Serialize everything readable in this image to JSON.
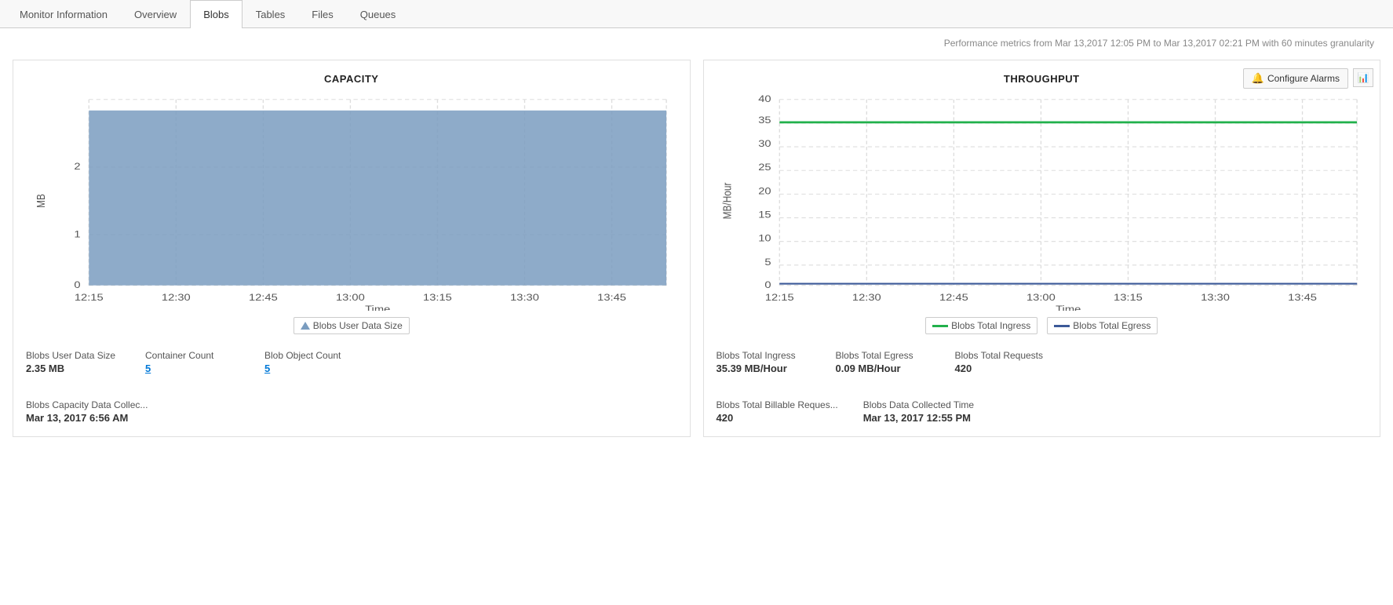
{
  "app": {
    "title": "Monitor Information"
  },
  "nav": {
    "tabs": [
      {
        "id": "monitor-information",
        "label": "Monitor Information",
        "active": false
      },
      {
        "id": "overview",
        "label": "Overview",
        "active": false
      },
      {
        "id": "blobs",
        "label": "Blobs",
        "active": true
      },
      {
        "id": "tables",
        "label": "Tables",
        "active": false
      },
      {
        "id": "files",
        "label": "Files",
        "active": false
      },
      {
        "id": "queues",
        "label": "Queues",
        "active": false
      }
    ]
  },
  "metrics_info": "Performance metrics from Mar 13,2017 12:05 PM to Mar 13,2017 02:21 PM with 60 minutes granularity",
  "capacity_panel": {
    "title": "CAPACITY",
    "x_axis_label": "Time",
    "y_axis_label": "MB",
    "x_ticks": [
      "12:15",
      "12:30",
      "12:45",
      "13:00",
      "13:15",
      "13:30",
      "13:45"
    ],
    "y_ticks": [
      "0",
      "1",
      "2"
    ],
    "legend": [
      {
        "label": "Blobs User Data Size",
        "type": "triangle",
        "color": "#7a9cbf"
      }
    ],
    "stats": [
      {
        "label": "Blobs User Data Size",
        "value": "2.35 MB",
        "is_link": false
      },
      {
        "label": "Container Count",
        "value": "5",
        "is_link": true
      },
      {
        "label": "Blob Object Count",
        "value": "5",
        "is_link": true
      },
      {
        "label": "Blobs Capacity Data Collec...",
        "value": "Mar 13, 2017 6:56 AM",
        "is_link": false
      }
    ]
  },
  "throughput_panel": {
    "title": "THROUGHPUT",
    "x_axis_label": "Time",
    "y_axis_label": "MB/Hour",
    "x_ticks": [
      "12:15",
      "12:30",
      "12:45",
      "13:00",
      "13:15",
      "13:30",
      "13:45"
    ],
    "y_ticks": [
      "0",
      "5",
      "10",
      "15",
      "20",
      "25",
      "30",
      "35",
      "40"
    ],
    "legend": [
      {
        "label": "Blobs Total Ingress",
        "type": "line-green",
        "color": "#22b14c"
      },
      {
        "label": "Blobs Total Egress",
        "type": "line-blue",
        "color": "#3b5998"
      }
    ],
    "configure_alarms_label": "Configure Alarms",
    "stats": [
      {
        "label": "Blobs Total Ingress",
        "value": "35.39 MB/Hour",
        "is_link": false
      },
      {
        "label": "Blobs Total Egress",
        "value": "0.09 MB/Hour",
        "is_link": false
      },
      {
        "label": "Blobs Total Requests",
        "value": "420",
        "is_link": false
      },
      {
        "label": "Blobs Total Billable Reques...",
        "value": "420",
        "is_link": false
      },
      {
        "label": "Blobs Data Collected Time",
        "value": "Mar 13, 2017 12:55 PM",
        "is_link": false
      }
    ]
  }
}
